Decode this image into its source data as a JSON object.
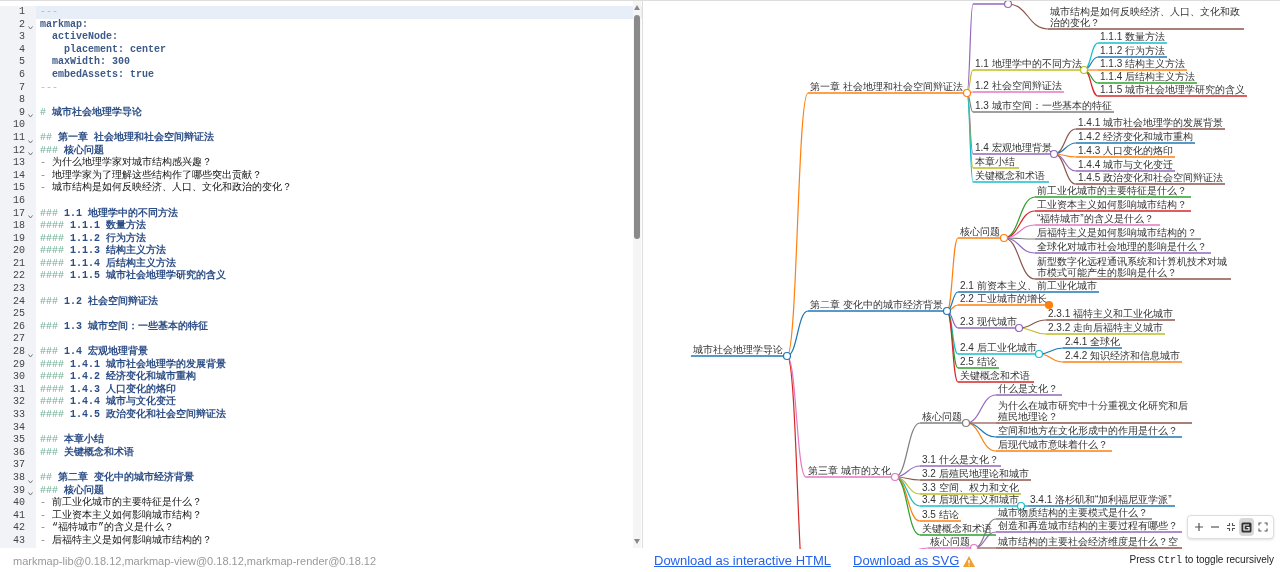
{
  "editor": {
    "lines": [
      {
        "number": "1",
        "kind": "fence",
        "text": "---",
        "foldable": false,
        "active": true
      },
      {
        "number": "2",
        "kind": "yaml",
        "text": "markmap:",
        "foldable": true,
        "active": false
      },
      {
        "number": "3",
        "kind": "yaml",
        "text": "  activeNode:",
        "foldable": false,
        "active": false
      },
      {
        "number": "4",
        "kind": "yaml",
        "text": "    placement: center",
        "foldable": false,
        "active": false
      },
      {
        "number": "5",
        "kind": "yaml",
        "text": "  maxWidth: 300",
        "foldable": false,
        "active": false
      },
      {
        "number": "6",
        "kind": "yaml",
        "text": "  embedAssets: true",
        "foldable": false,
        "active": false
      },
      {
        "number": "7",
        "kind": "fence",
        "text": "---",
        "foldable": false,
        "active": false
      },
      {
        "number": "8",
        "kind": "blank",
        "foldable": false,
        "active": false
      },
      {
        "number": "9",
        "kind": "heading",
        "marker": "#",
        "text": "城市社会地理学导论",
        "foldable": true,
        "active": false
      },
      {
        "number": "10",
        "kind": "blank",
        "foldable": false,
        "active": false
      },
      {
        "number": "11",
        "kind": "heading",
        "marker": "##",
        "text": "第一章 社会地理和社会空间辩证法",
        "foldable": true,
        "active": false
      },
      {
        "number": "12",
        "kind": "heading",
        "marker": "###",
        "text": "核心问题",
        "foldable": true,
        "active": false
      },
      {
        "number": "13",
        "kind": "list",
        "marker": "-",
        "text": "为什么地理学家对城市结构感兴趣？",
        "foldable": false,
        "active": false
      },
      {
        "number": "14",
        "kind": "list",
        "marker": "-",
        "text": "地理学家为了理解这些结构作了哪些突出贡献？",
        "foldable": false,
        "active": false
      },
      {
        "number": "15",
        "kind": "list",
        "marker": "-",
        "text": "城市结构是如何反映经济、人口、文化和政治的变化？",
        "foldable": false,
        "active": false
      },
      {
        "number": "16",
        "kind": "blank",
        "foldable": false,
        "active": false
      },
      {
        "number": "17",
        "kind": "heading",
        "marker": "###",
        "text": "1.1 地理学中的不同方法",
        "foldable": true,
        "active": false
      },
      {
        "number": "18",
        "kind": "heading",
        "marker": "####",
        "text": "1.1.1 数量方法",
        "foldable": false,
        "active": false
      },
      {
        "number": "19",
        "kind": "heading",
        "marker": "####",
        "text": "1.1.2 行为方法",
        "foldable": false,
        "active": false
      },
      {
        "number": "20",
        "kind": "heading",
        "marker": "####",
        "text": "1.1.3 结构主义方法",
        "foldable": false,
        "active": false
      },
      {
        "number": "21",
        "kind": "heading",
        "marker": "####",
        "text": "1.1.4 后结构主义方法",
        "foldable": false,
        "active": false
      },
      {
        "number": "22",
        "kind": "heading",
        "marker": "####",
        "text": "1.1.5 城市社会地理学研究的含义",
        "foldable": false,
        "active": false
      },
      {
        "number": "23",
        "kind": "blank",
        "foldable": false,
        "active": false
      },
      {
        "number": "24",
        "kind": "heading",
        "marker": "###",
        "text": "1.2 社会空间辩证法",
        "foldable": false,
        "active": false
      },
      {
        "number": "25",
        "kind": "blank",
        "foldable": false,
        "active": false
      },
      {
        "number": "26",
        "kind": "heading",
        "marker": "###",
        "text": "1.3 城市空间：一些基本的特征",
        "foldable": false,
        "active": false
      },
      {
        "number": "27",
        "kind": "blank",
        "foldable": false,
        "active": false
      },
      {
        "number": "28",
        "kind": "heading",
        "marker": "###",
        "text": "1.4 宏观地理背景",
        "foldable": true,
        "active": false
      },
      {
        "number": "29",
        "kind": "heading",
        "marker": "####",
        "text": "1.4.1 城市社会地理学的发展背景",
        "foldable": false,
        "active": false
      },
      {
        "number": "30",
        "kind": "heading",
        "marker": "####",
        "text": "1.4.2 经济变化和城市重构",
        "foldable": false,
        "active": false
      },
      {
        "number": "31",
        "kind": "heading",
        "marker": "####",
        "text": "1.4.3 人口变化的烙印",
        "foldable": false,
        "active": false
      },
      {
        "number": "32",
        "kind": "heading",
        "marker": "####",
        "text": "1.4.4 城市与文化变迁",
        "foldable": false,
        "active": false
      },
      {
        "number": "33",
        "kind": "heading",
        "marker": "####",
        "text": "1.4.5 政治变化和社会空间辩证法",
        "foldable": false,
        "active": false
      },
      {
        "number": "34",
        "kind": "blank",
        "foldable": false,
        "active": false
      },
      {
        "number": "35",
        "kind": "heading",
        "marker": "###",
        "text": "本章小结",
        "foldable": false,
        "active": false
      },
      {
        "number": "36",
        "kind": "heading",
        "marker": "###",
        "text": "关键概念和术语",
        "foldable": false,
        "active": false
      },
      {
        "number": "37",
        "kind": "blank",
        "foldable": false,
        "active": false
      },
      {
        "number": "38",
        "kind": "heading",
        "marker": "##",
        "text": "第二章 变化中的城市经济背景",
        "foldable": true,
        "active": false
      },
      {
        "number": "39",
        "kind": "heading",
        "marker": "###",
        "text": "核心问题",
        "foldable": true,
        "active": false
      },
      {
        "number": "40",
        "kind": "list",
        "marker": "-",
        "text": "前工业化城市的主要特征是什么？",
        "foldable": false,
        "active": false
      },
      {
        "number": "41",
        "kind": "list",
        "marker": "-",
        "text": "工业资本主义如何影响城市结构？",
        "foldable": false,
        "active": false
      },
      {
        "number": "42",
        "kind": "list",
        "marker": "-",
        "text": "“福特城市”的含义是什么？",
        "foldable": false,
        "active": false
      },
      {
        "number": "43",
        "kind": "list",
        "marker": "-",
        "text": "后福特主义是如何影响城市结构的？",
        "foldable": false,
        "active": false
      }
    ]
  },
  "mindmap": {
    "root": {
      "label": "城市社会地理学导论",
      "children": [
        {
          "label": "第一章 社会地理和社会空间辩证法",
          "children": [
            {
              "children": [
                {
                  "label": "城市结构是如何反映经济、人口、文化和政治的变化？"
                }
              ]
            },
            {
              "label": "1.1 地理学中的不同方法",
              "children": [
                {
                  "label": "1.1.1 数量方法"
                },
                {
                  "label": "1.1.2 行为方法"
                },
                {
                  "label": "1.1.3 结构主义方法"
                },
                {
                  "label": "1.1.4 后结构主义方法"
                },
                {
                  "label": "1.1.5 城市社会地理学研究的含义"
                }
              ]
            },
            {
              "label": "1.2 社会空间辩证法"
            },
            {
              "label": "1.3 城市空间：一些基本的特征"
            },
            {
              "label": "1.4 宏观地理背景",
              "children": [
                {
                  "label": "1.4.1 城市社会地理学的发展背景"
                },
                {
                  "label": "1.4.2 经济变化和城市重构"
                },
                {
                  "label": "1.4.3 人口变化的烙印"
                },
                {
                  "label": "1.4.4 城市与文化变迁"
                },
                {
                  "label": "1.4.5 政治变化和社会空间辩证法"
                }
              ]
            },
            {
              "label": "本章小结"
            },
            {
              "label": "关键概念和术语"
            }
          ]
        },
        {
          "label": "第二章 变化中的城市经济背景",
          "children": [
            {
              "label": "核心问题",
              "children": [
                {
                  "label": "前工业化城市的主要特征是什么？"
                },
                {
                  "label": "工业资本主义如何影响城市结构？"
                },
                {
                  "label": "“福特城市”的含义是什么？"
                },
                {
                  "label": "后福特主义是如何影响城市结构的？"
                },
                {
                  "label": "全球化对城市社会地理的影响是什么？"
                },
                {
                  "label": "新型数字化远程通讯系统和计算机技术对城市模式可能产生的影响是什么？"
                }
              ]
            },
            {
              "label": "2.1 前资本主义、前工业化城市"
            },
            {
              "label": "2.2 工业城市的增长",
              "collapsed": true
            },
            {
              "label": "2.3 现代城市",
              "children": [
                {
                  "label": "2.3.1 福特主义和工业化城市"
                },
                {
                  "label": "2.3.2 走向后福特主义城市"
                }
              ]
            },
            {
              "label": "2.4 后工业化城市",
              "children": [
                {
                  "label": "2.4.1 全球化"
                },
                {
                  "label": "2.4.2 知识经济和信息城市"
                }
              ]
            },
            {
              "label": "2.5 结论"
            },
            {
              "label": "关键概念和术语"
            }
          ]
        },
        {
          "label": "第三章 城市的文化",
          "children": [
            {
              "label": "核心问题",
              "children": [
                {
                  "label": "什么是文化？"
                },
                {
                  "label": "为什么在城市研究中十分重视文化研究和后殖民地理论？"
                },
                {
                  "label": "空间和地方在文化形成中的作用是什么？"
                },
                {
                  "label": "后现代城市意味着什么？"
                }
              ]
            },
            {
              "label": "3.1 什么是文化？"
            },
            {
              "label": "3.2 后殖民地理论和城市"
            },
            {
              "label": "3.3 空间、权力和文化"
            },
            {
              "label": "3.4 后现代主义和城市",
              "children": [
                {
                  "label": "3.4.1 洛杉矶和“加利福尼亚学派”"
                }
              ]
            },
            {
              "label": "3.5 结论"
            },
            {
              "label": "关键概念和术语"
            }
          ]
        },
        {
          "children": [
            {
              "label": "核心问题",
              "children": [
                {
                  "label": "城市物质结构的主要模式是什么？"
                },
                {
                  "label": "创造和再造城市结构的主要过程有哪些？"
                },
                {
                  "label": "城市结构的主要社会经济维度是什么？空"
                }
              ]
            }
          ]
        }
      ]
    }
  },
  "toolbar": [
    {
      "kind": "zoom-in",
      "selected": false
    },
    {
      "kind": "zoom-out",
      "selected": false
    },
    {
      "kind": "fit",
      "selected": false
    },
    {
      "kind": "logo",
      "selected": true
    },
    {
      "kind": "fullscreen",
      "selected": false
    }
  ],
  "footer": {
    "versions": "markmap-lib@0.18.12,markmap-view@0.18.12,markmap-render@0.18.12",
    "links": [
      "Download as interactive HTML",
      "Download as SVG"
    ],
    "hint_before": "Press",
    "hint_key": "Ctrl",
    "hint_after": "to toggle recursively"
  }
}
